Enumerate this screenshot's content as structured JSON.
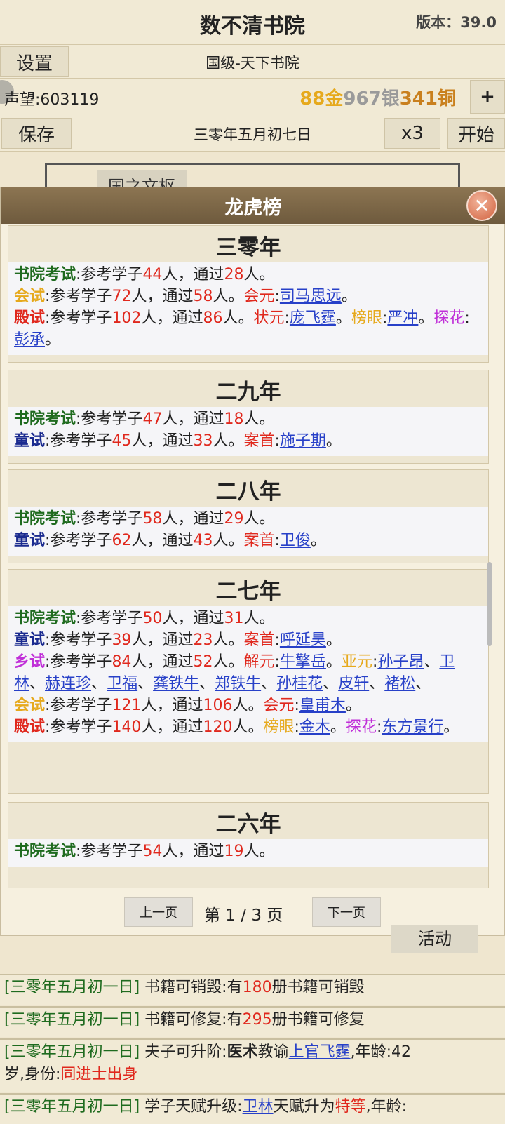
{
  "header": {
    "title": "数不清书院",
    "version": "版本：39.0"
  },
  "toolbar": {
    "settings_label": "设置",
    "academy_level": "国级-天下书院",
    "reputation": "声望:603119",
    "gold": "88",
    "gold_unit": "金",
    "silver": "967",
    "silver_unit": "银",
    "copper": "341",
    "copper_unit": "铜",
    "add_label": "+",
    "save_label": "保存",
    "date": "三零年五月初七日",
    "speed_label": "x3",
    "start_label": "开始"
  },
  "background": {
    "tab_label": "国之文枢",
    "activity_label": "活动"
  },
  "dialog": {
    "title": "龙虎榜",
    "close_label": "✕",
    "years": [
      {
        "year": "三零年",
        "school": {
          "label": "书院考试",
          "text1": ":参考学子",
          "n1": "44",
          "text2": "人，通过",
          "n2": "28",
          "text3": "人。"
        },
        "hui": {
          "label": "会试",
          "text1": ":参考学子",
          "n1": "72",
          "text2": "人，通过",
          "n2": "58",
          "text3": "人。",
          "title": "会元",
          "name": "司马思远"
        },
        "dian": {
          "label": "殿试",
          "text1": ":参考学子",
          "n1": "102",
          "text2": "人，通过",
          "n2": "86",
          "text3": "人。",
          "t1": "状元",
          "name1": "庞飞霆",
          "t2": "榜眼",
          "name2": "严冲",
          "t3": "探花",
          "name3": "彭承"
        }
      },
      {
        "year": "二九年",
        "school": {
          "label": "书院考试",
          "text1": ":参考学子",
          "n1": "47",
          "text2": "人，通过",
          "n2": "18",
          "text3": "人。"
        },
        "tong": {
          "label": "童试",
          "text1": ":参考学子",
          "n1": "45",
          "text2": "人，通过",
          "n2": "33",
          "text3": "人。",
          "title": "案首",
          "name": "施子期"
        }
      },
      {
        "year": "二八年",
        "school": {
          "label": "书院考试",
          "text1": ":参考学子",
          "n1": "58",
          "text2": "人，通过",
          "n2": "29",
          "text3": "人。"
        },
        "tong": {
          "label": "童试",
          "text1": ":参考学子",
          "n1": "62",
          "text2": "人，通过",
          "n2": "43",
          "text3": "人。",
          "title": "案首",
          "name": "卫俊"
        }
      },
      {
        "year": "二七年",
        "school": {
          "label": "书院考试",
          "text1": ":参考学子",
          "n1": "50",
          "text2": "人，通过",
          "n2": "31",
          "text3": "人。"
        },
        "tong": {
          "label": "童试",
          "text1": ":参考学子",
          "n1": "39",
          "text2": "人，通过",
          "n2": "23",
          "text3": "人。",
          "title": "案首",
          "name": "呼延昊"
        },
        "xiang": {
          "label": "乡试",
          "text1": ":参考学子",
          "n1": "84",
          "text2": "人，通过",
          "n2": "52",
          "text3": "人。",
          "t1": "解元",
          "name1": "牛擎岳",
          "t2": "亚元",
          "names2": [
            "孙子昂",
            "卫林",
            "赫连珍",
            "卫福",
            "龚铁牛",
            "郑铁牛",
            "孙桂花",
            "皮轩",
            "褚松"
          ]
        },
        "hui": {
          "label": "会试",
          "text1": ":参考学子",
          "n1": "121",
          "text2": "人，通过",
          "n2": "106",
          "text3": "人。",
          "title": "会元",
          "name": "皇甫木"
        },
        "dian": {
          "label": "殿试",
          "text1": ":参考学子",
          "n1": "140",
          "text2": "人，通过",
          "n2": "120",
          "text3": "人。",
          "t2": "榜眼",
          "name2": "金木",
          "t3": "探花",
          "name3": "东方景行"
        }
      },
      {
        "year": "二六年",
        "school": {
          "label": "书院考试",
          "text1": ":参考学子",
          "n1": "54",
          "text2": "人，通过",
          "n2": "19",
          "text3": "人。"
        }
      }
    ],
    "pager": {
      "prev_label": "上一页",
      "page_text": "第 1 / 3 页",
      "next_label": "下一页"
    }
  },
  "logs": [
    {
      "date": "[三零年五月初一日]",
      "pre": " 书籍可销毁:有",
      "num": "180",
      "post": "册书籍可销毁"
    },
    {
      "date": "[三零年五月初一日]",
      "pre": " 书籍可修复:有",
      "num": "295",
      "post": "册书籍可修复"
    },
    {
      "date": "[三零年五月初一日]",
      "pre": " 夫子可升阶:",
      "bold": "医术",
      "mid": "教谕",
      "name": "上官飞霆",
      "age_label": ",年龄:",
      "age": "42",
      "line2_pre": "岁,身份:",
      "status": "同进士出身"
    },
    {
      "date": "[三零年五月初一日]",
      "pre": " 学子天赋升级:",
      "name": "卫林",
      "mid": "天赋升为",
      "grade": "特等",
      "age_label": ",年龄:"
    }
  ]
}
